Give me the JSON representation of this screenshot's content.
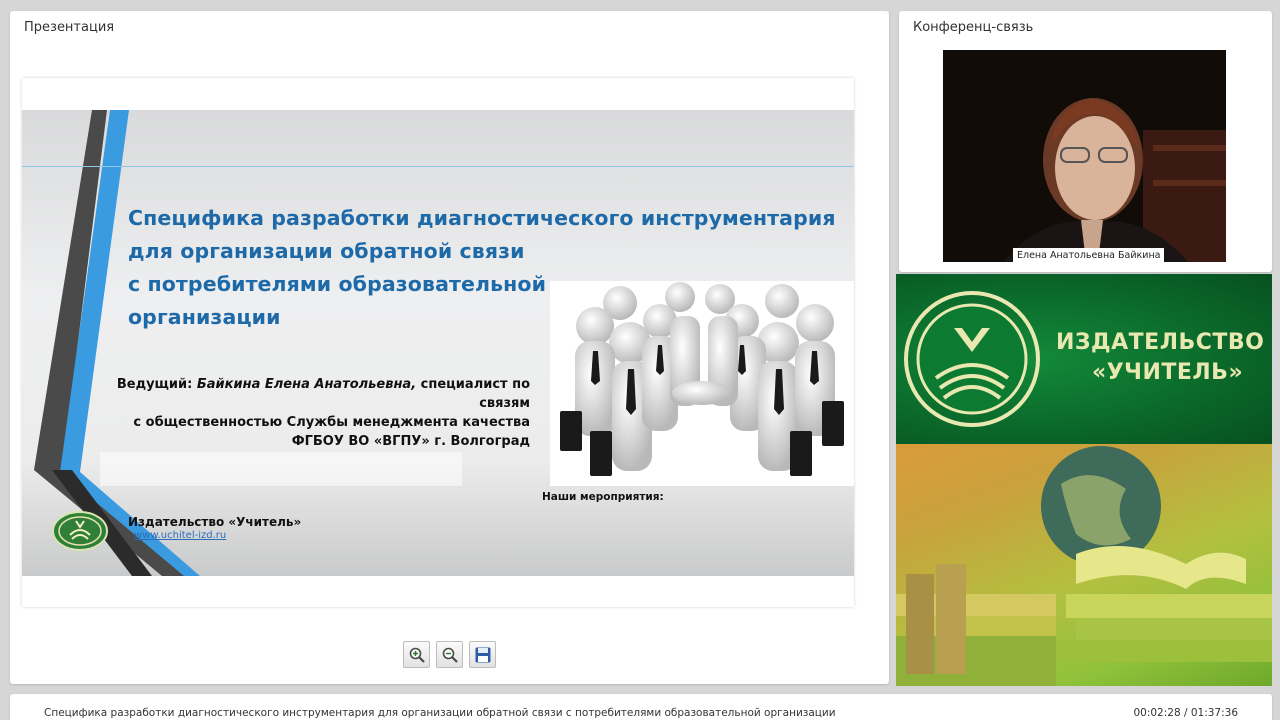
{
  "presentation": {
    "title": "Презентация",
    "slide": {
      "title_lines": [
        "Специфика разработки диагностического инструментария",
        "для организации обратной связи",
        "с потребителями образовательной",
        "организации"
      ],
      "host_label": "Ведущий: ",
      "host_name": "Байкина Елена Анатольевна,",
      "host_role1": " специалист по связям",
      "host_role2": "с общественностью Службы менеджмента качества",
      "host_org": "ФГБОУ ВО «ВГПУ» г. Волгоград",
      "publisher": "Издательство «Учитель»",
      "url": "www.uchitel-izd.ru",
      "events_title": "Наши мероприятия:"
    },
    "toolbar": {
      "zoom_in": "zoom-in",
      "zoom_out": "zoom-out",
      "save": "save"
    }
  },
  "conference": {
    "title": "Конференц-связь",
    "speaker": "Елена Анатольевна Байкина"
  },
  "banner": {
    "line1": "ИЗДАТЕЛЬСТВО",
    "line2": "«УЧИТЕЛЬ»"
  },
  "footer": {
    "title": "Специфика разработки диагностического инструментария для организации обратной связи с потребителями образовательной организации",
    "time": "00:02:28 / 01:37:36"
  },
  "colors": {
    "title_blue": "#1e6aa8",
    "stripe_blue": "#3a9be0",
    "banner_green": "#0b6a2b"
  }
}
